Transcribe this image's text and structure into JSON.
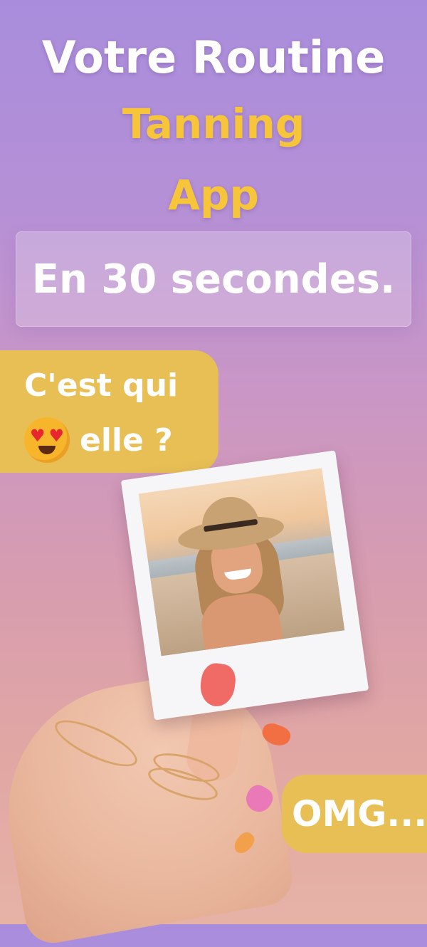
{
  "headline": {
    "line1": "Votre Routine",
    "line2": "Tanning",
    "line3": "App"
  },
  "subtitle": "En 30 secondes.",
  "question_bubble": {
    "line1": "C'est qui",
    "line2_text": "elle ?",
    "emoji": "heart-eyes-emoji"
  },
  "reaction_bubble": "OMG...",
  "colors": {
    "accent_yellow": "#f6c53a",
    "bubble": "#e8bf55",
    "text_white": "#ffffff"
  }
}
